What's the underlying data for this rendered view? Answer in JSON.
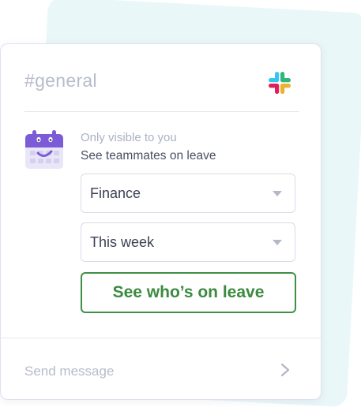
{
  "channel": {
    "name": "#general"
  },
  "message": {
    "visibility_note": "Only visible to you",
    "text": "See teammates on leave"
  },
  "filters": {
    "department": {
      "selected": "Finance"
    },
    "period": {
      "selected": "This week"
    }
  },
  "action": {
    "label": "See who’s on leave"
  },
  "composer": {
    "placeholder": "Send message"
  },
  "icons": {
    "logo": "slack-logo",
    "avatar": "calendar-face-icon",
    "dropdown": "chevron-down-icon",
    "send": "chevron-right-icon"
  },
  "colors": {
    "accent_green": "#3e9044",
    "avatar_purple": "#7b5cd6",
    "slack_blue": "#36c5f0",
    "slack_green": "#2eb67d",
    "slack_red": "#e01e5a",
    "slack_yellow": "#ecb22e"
  }
}
